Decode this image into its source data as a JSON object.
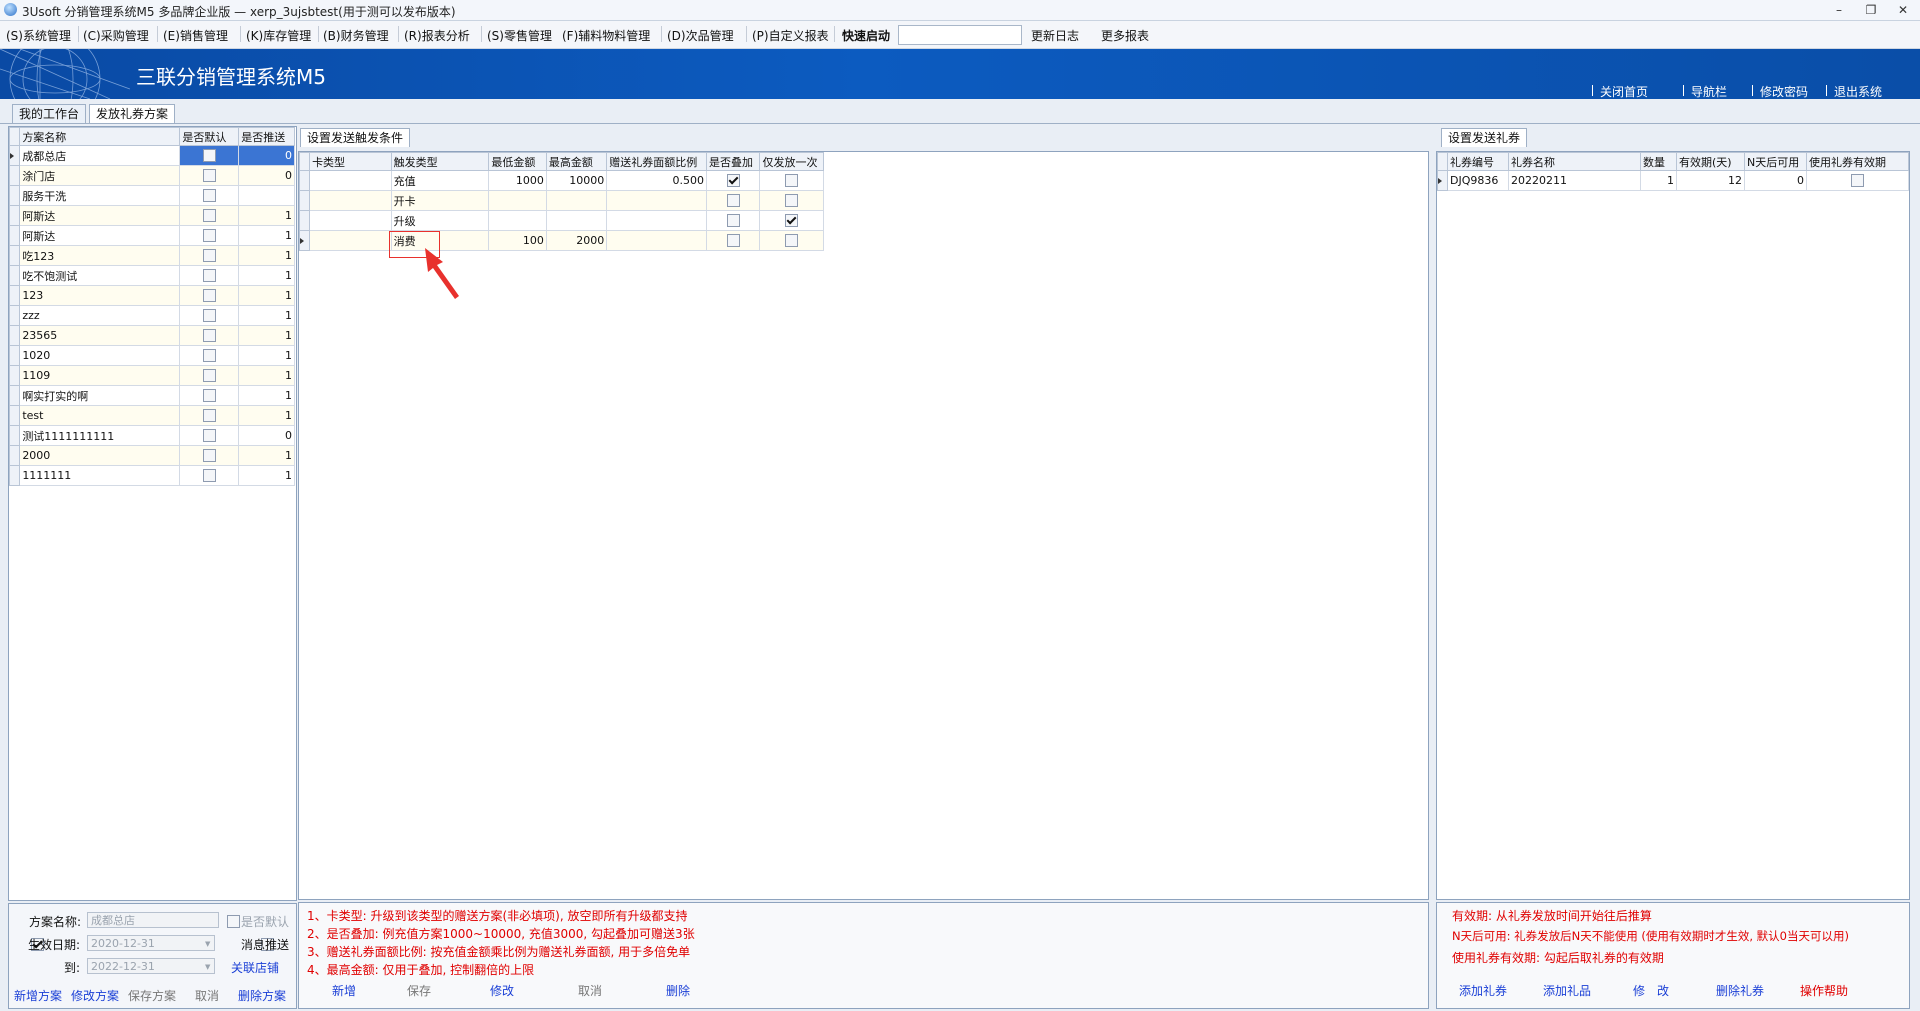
{
  "window": {
    "title": "3Usoft 分销管理系统M5 多品牌企业版 — xerp_3ujsbtest(用于测可以发布版本)",
    "buttons": {
      "minimize": "–",
      "restore": "❐",
      "close": "✕"
    }
  },
  "menu": {
    "items": [
      "(S)系统管理",
      "(C)采购管理",
      "(E)销售管理",
      "(K)库存管理",
      "(B)财务管理",
      "(R)报表分析",
      "(S)零售管理",
      "(F)辅料物料管理",
      "(D)次品管理",
      "(P)自定义报表"
    ],
    "quick_start_label": "快速启动",
    "quick_start_value": "",
    "update_log": "更新日志",
    "more_reports": "更多报表"
  },
  "banner": {
    "title": "三联分销管理系统M5",
    "links": [
      "关闭首页",
      "导航栏",
      "修改密码",
      "退出系统"
    ]
  },
  "tabs": [
    "我的工作台",
    "发放礼券方案"
  ],
  "plans": {
    "headers": [
      "方案名称",
      "是否默认",
      "是否推送"
    ],
    "rows": [
      {
        "name": "成都总店",
        "default": false,
        "push": "0"
      },
      {
        "name": "涂门店",
        "default": false,
        "push": "0"
      },
      {
        "name": "服务干洗",
        "default": false,
        "push": ""
      },
      {
        "name": "阿斯达",
        "default": false,
        "push": "1"
      },
      {
        "name": "阿斯达",
        "default": false,
        "push": "1"
      },
      {
        "name": "吃123",
        "default": false,
        "push": "1"
      },
      {
        "name": "吃不饱测试",
        "default": false,
        "push": "1"
      },
      {
        "name": "123",
        "default": false,
        "push": "1"
      },
      {
        "name": "zzz",
        "default": false,
        "push": "1"
      },
      {
        "name": "23565",
        "default": false,
        "push": "1"
      },
      {
        "name": "1020",
        "default": false,
        "push": "1"
      },
      {
        "name": "1109",
        "default": false,
        "push": "1"
      },
      {
        "name": "啊实打实的啊",
        "default": false,
        "push": "1"
      },
      {
        "name": "test",
        "default": false,
        "push": "1"
      },
      {
        "name": "测试1111111111",
        "default": false,
        "push": "0"
      },
      {
        "name": "2000",
        "default": false,
        "push": "1"
      },
      {
        "name": "1111111",
        "default": false,
        "push": "1"
      }
    ]
  },
  "plan_form": {
    "name_label": "方案名称:",
    "name_value": "成都总店",
    "is_default_label": "是否默认",
    "effective_label": "生效日期:",
    "effective_checked": true,
    "effective_from": "2020-12-31",
    "to_label": "到:",
    "effective_to": "2022-12-31",
    "message_push_label": "消息推送",
    "link_stores": "关联店铺",
    "buttons": {
      "new": "新增方案",
      "edit": "修改方案",
      "save": "保存方案",
      "cancel": "取消",
      "delete": "删除方案"
    }
  },
  "trigger": {
    "tab": "设置发送触发条件",
    "headers": [
      "卡类型",
      "触发类型",
      "最低金额",
      "最高金额",
      "赠送礼券面额比例",
      "是否叠加",
      "仅发放一次"
    ],
    "rows": [
      {
        "card": "",
        "type": "充值",
        "min": "1000",
        "max": "10000",
        "ratio": "0.500",
        "stack": true,
        "once": false
      },
      {
        "card": "",
        "type": "开卡",
        "min": "",
        "max": "",
        "ratio": "",
        "stack": false,
        "once": false
      },
      {
        "card": "",
        "type": "升级",
        "min": "",
        "max": "",
        "ratio": "",
        "stack": false,
        "once": true
      },
      {
        "card": "",
        "type": "消费",
        "min": "100",
        "max": "2000",
        "ratio": "",
        "stack": false,
        "once": false
      }
    ],
    "notes": [
      "1、卡类型: 升级到该类型的赠送方案(非必填项), 放空即所有升级都支持",
      "2、是否叠加: 例充值方案1000~10000, 充值3000, 勾起叠加可赠送3张",
      "3、赠送礼券面额比例: 按充值金额乘比例为赠送礼券面额, 用于多倍免单",
      "4、最高金额: 仅用于叠加, 控制翻倍的上限"
    ],
    "buttons": {
      "new": "新增",
      "save": "保存",
      "edit": "修改",
      "cancel": "取消",
      "delete": "删除"
    }
  },
  "coupons": {
    "tab": "设置发送礼券",
    "headers": [
      "礼券编号",
      "礼券名称",
      "数量",
      "有效期(天)",
      "N天后可用",
      "使用礼券有效期"
    ],
    "rows": [
      {
        "code": "DJQ9836",
        "name": "20220211",
        "qty": "1",
        "valid_days": "12",
        "n_days": "0",
        "use_validity": false
      }
    ],
    "notes": [
      "有效期: 从礼券发放时间开始往后推算",
      "N天后可用: 礼券发放后N天不能使用 (使用有效期时才生效, 默认0当天可以用)",
      "使用礼券有效期: 勾起后取礼券的有效期"
    ],
    "buttons": {
      "add_coupon": "添加礼券",
      "add_gift": "添加礼品",
      "edit": "修　改",
      "delete": "删除礼券",
      "help": "操作帮助"
    }
  },
  "colors": {
    "banner": "#0c5bc0",
    "note_red": "#e00000",
    "link_blue": "#1a3fd6",
    "selection": "#3b75d3",
    "highlight_box": "#e8312d"
  }
}
